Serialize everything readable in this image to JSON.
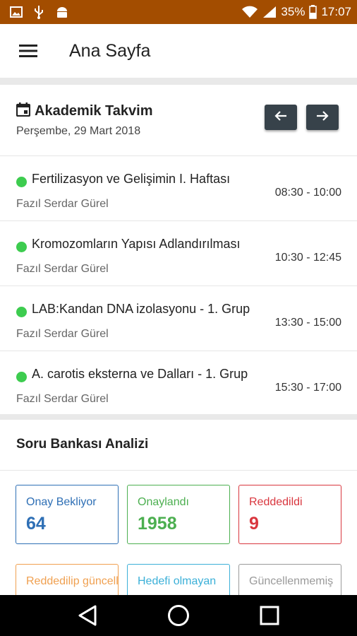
{
  "status_bar": {
    "battery": "35%",
    "time": "17:07",
    "icons": [
      "image-icon",
      "usb-icon",
      "android-icon",
      "wifi-icon",
      "signal-icon",
      "battery-icon"
    ]
  },
  "app_bar": {
    "title": "Ana Sayfa",
    "menu_icon": "hamburger-menu-icon"
  },
  "calendar": {
    "title": "Akademik Takvim",
    "date": "Perşembe, 29 Mart 2018",
    "icon": "calendar-icon",
    "prev_icon": "arrow-left-icon",
    "next_icon": "arrow-right-icon",
    "events": [
      {
        "title": "Fertilizasyon ve Gelişimin I. Haftası",
        "person": "Fazıl Serdar Gürel",
        "time": "08:30 - 10:00"
      },
      {
        "title": "Kromozomların Yapısı Adlandırılması",
        "person": "Fazıl Serdar Gürel",
        "time": "10:30 - 12:45"
      },
      {
        "title": "LAB:Kandan DNA izolasyonu - 1. Grup",
        "person": "Fazıl Serdar Gürel",
        "time": "13:30 - 15:00"
      },
      {
        "title": "A. carotis eksterna ve Dalları - 1. Grup",
        "person": "Fazıl Serdar Gürel",
        "time": "15:30 - 17:00"
      }
    ]
  },
  "question_bank": {
    "title": "Soru Bankası Analizi",
    "cards": [
      {
        "label": "Onay Bekliyor",
        "value": "64",
        "color": "#2e6fb5"
      },
      {
        "label": "Onaylandı",
        "value": "1958",
        "color": "#4caf50"
      },
      {
        "label": "Reddedildi",
        "value": "9",
        "color": "#d9363e"
      },
      {
        "label": "Reddedilip güncellenmeyen",
        "value": "",
        "color": "#f0a050"
      },
      {
        "label": "Hedefi olmayan",
        "value": "",
        "color": "#3bb0d8"
      },
      {
        "label": "Güncellenmemiş",
        "value": "",
        "color": "#9a9a9a"
      }
    ]
  },
  "nav_bar": {
    "back_icon": "back-triangle-icon",
    "home_icon": "home-circle-icon",
    "recents_icon": "recents-square-icon"
  }
}
